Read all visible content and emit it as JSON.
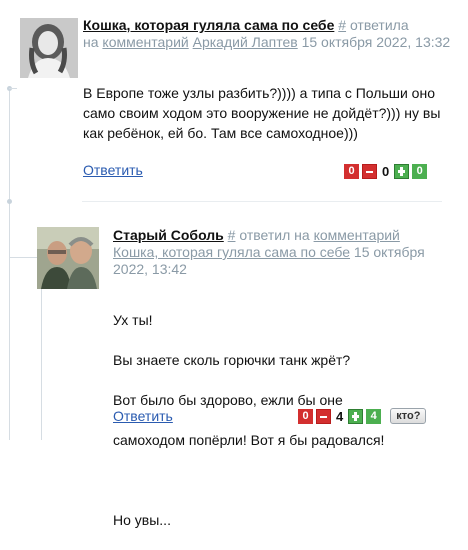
{
  "comment1": {
    "author": "Кошка, которая гуляла сама по себе",
    "hash": "#",
    "action": "ответила",
    "on_word": "на",
    "target_link": "комментарий",
    "target_author": "Аркадий Лаптев",
    "date": "15 октября 2022, 13:32",
    "text": "В Европе тоже узлы разбить?)))) а типа с Польши оно само своим ходом это вооружение не дойдёт?))) ну вы как ребёнок, ей бо. Там все самоходное)))",
    "reply_label": "Ответить",
    "votes": {
      "minus_count": "0",
      "score": "0",
      "plus_count": "0"
    }
  },
  "comment2": {
    "author": "Старый Соболь",
    "hash": "#",
    "action": "ответил на",
    "target_link": "комментарий",
    "target_author": "Кошка, которая гуляла сама по себе",
    "date": "15 октября 2022, 13:42",
    "text_lines": [
      "Ух ты!",
      "Вы знаете сколь горючки танк жрёт?",
      "Вот было бы здорово, ежли бы оне",
      "самоходом попёрли! Вот я бы радовался!",
      "",
      "Но увы..."
    ],
    "reply_label": "Ответить",
    "votes": {
      "minus_count": "0",
      "score": "4",
      "plus_count": "4",
      "who_label": "кто?"
    }
  },
  "colors": {
    "link": "#2a5bb0",
    "muted": "#8a9aa6",
    "negative": "#d32f2f",
    "positive": "#4caf50"
  }
}
